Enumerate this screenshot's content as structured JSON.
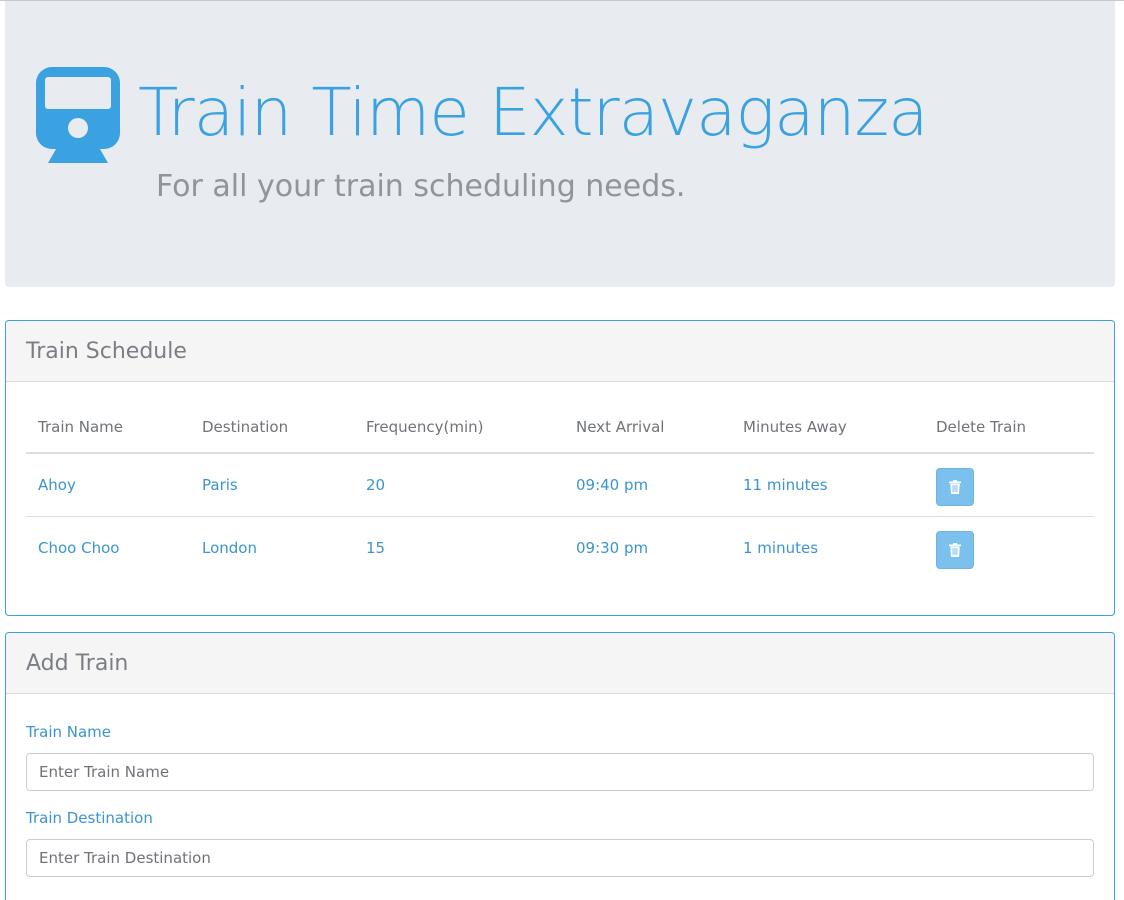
{
  "header": {
    "title": "Train Time Extravaganza",
    "subtitle": "For all your train scheduling needs.",
    "logo_icon": "train-icon",
    "accent_color": "#3aa2e0"
  },
  "schedule": {
    "title": "Train Schedule",
    "columns": [
      "Train Name",
      "Destination",
      "Frequency(min)",
      "Next Arrival",
      "Minutes Away",
      "Delete Train"
    ],
    "rows": [
      {
        "name": "Ahoy",
        "destination": "Paris",
        "frequency": "20",
        "next_arrival": "09:40 pm",
        "minutes_away": "11 minutes",
        "delete_icon": "trash-icon"
      },
      {
        "name": "Choo Choo",
        "destination": "London",
        "frequency": "15",
        "next_arrival": "09:30 pm",
        "minutes_away": "1 minutes",
        "delete_icon": "trash-icon"
      }
    ]
  },
  "add_train": {
    "title": "Add Train",
    "fields": [
      {
        "label": "Train Name",
        "placeholder": "Enter Train Name",
        "value": ""
      },
      {
        "label": "Train Destination",
        "placeholder": "Enter Train Destination",
        "value": ""
      }
    ]
  }
}
